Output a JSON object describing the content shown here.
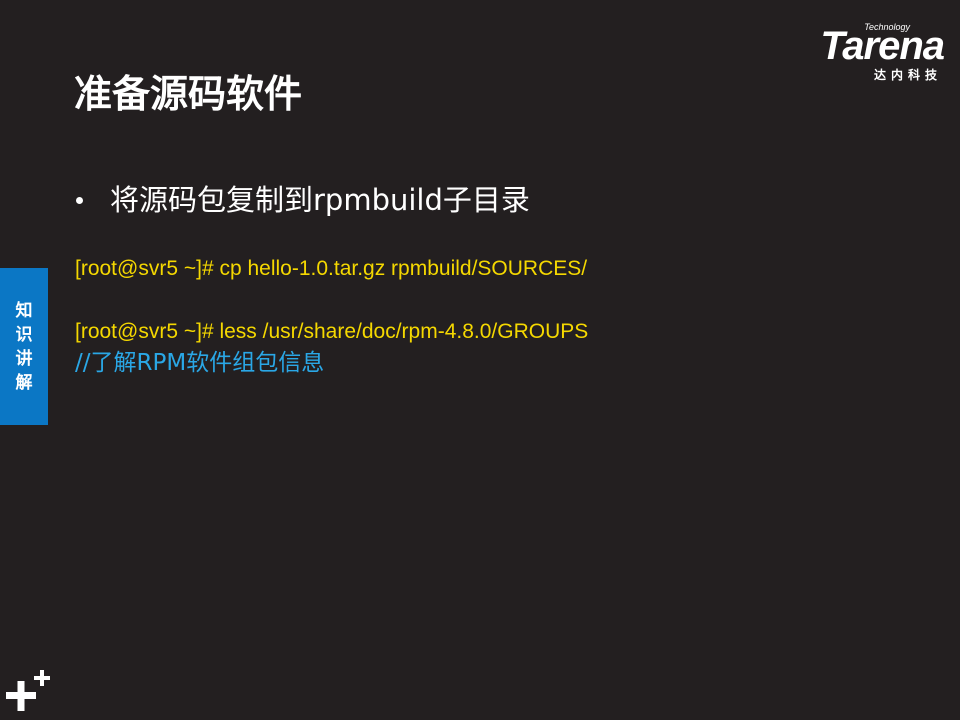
{
  "logo": {
    "tagline": "Technology",
    "wordmark": "Tarena",
    "subtitle": "达内科技"
  },
  "slide": {
    "title": "准备源码软件",
    "bullet": "将源码包复制到rpmbuild子目录",
    "commands": [
      "[root@svr5 ~]# cp hello-1.0.tar.gz rpmbuild/SOURCES/",
      "[root@svr5 ~]# less /usr/share/doc/rpm-4.8.0/GROUPS"
    ],
    "comment": "//了解RPM软件组包信息"
  },
  "side_tab": {
    "chars": [
      "知",
      "识",
      "讲",
      "解"
    ]
  },
  "colors": {
    "background": "#231f20",
    "command": "#f5d800",
    "comment": "#2aa7e6",
    "tab": "#0b77c5"
  },
  "icons": {
    "corner": "plus-icon"
  }
}
